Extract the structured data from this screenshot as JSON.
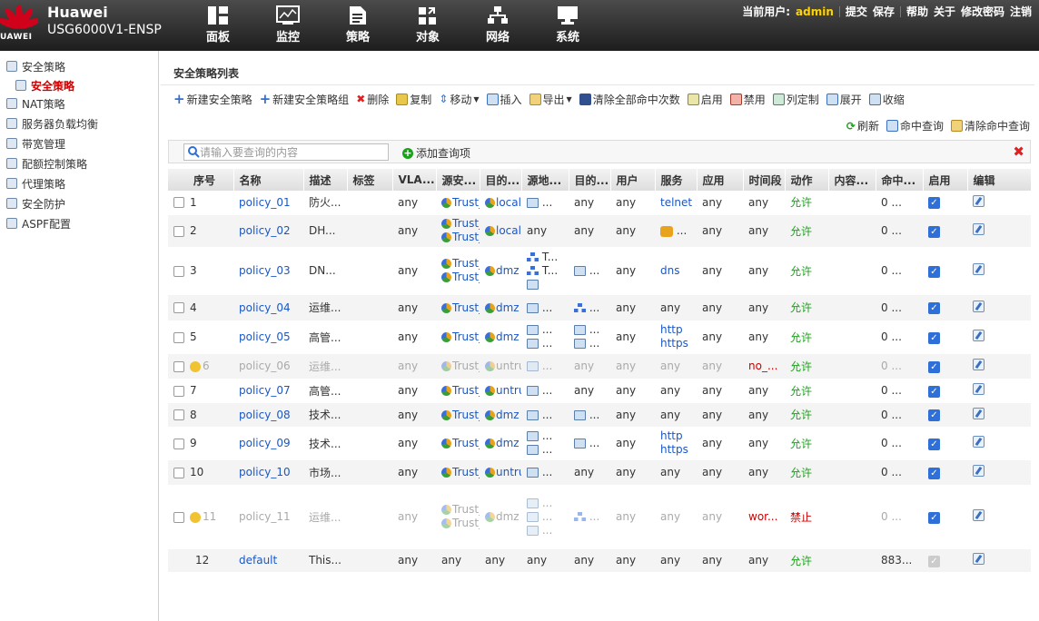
{
  "header": {
    "logo_text": "UAWEI",
    "brand": "Huawei",
    "model": "USG6000V1-ENSP",
    "nav": [
      "面板",
      "监控",
      "策略",
      "对象",
      "网络",
      "系统"
    ],
    "user_label": "当前用户:",
    "user_name": "admin",
    "links": [
      "提交",
      "保存",
      "帮助",
      "关于",
      "修改密码",
      "注销"
    ]
  },
  "sidebar": {
    "items": [
      "安全策略",
      "安全策略",
      "NAT策略",
      "服务器负载均衡",
      "带宽管理",
      "配额控制策略",
      "代理策略",
      "安全防护",
      "ASPF配置"
    ]
  },
  "main": {
    "title": "安全策略列表",
    "toolbar": [
      "新建安全策略",
      "新建安全策略组",
      "删除",
      "复制",
      "移动",
      "插入",
      "导出",
      "清除全部命中次数",
      "启用",
      "禁用",
      "列定制",
      "展开",
      "收缩"
    ],
    "toolbar2": [
      "刷新",
      "命中查询",
      "清除命中查询"
    ],
    "search_placeholder": "请输入要查询的内容",
    "add_query": "添加查询项"
  },
  "table": {
    "columns": [
      "序号",
      "名称",
      "描述",
      "标签",
      "VLA...",
      "源安...",
      "目的...",
      "源地...",
      "目的...",
      "用户",
      "服务",
      "应用",
      "时间段",
      "动作",
      "内容...",
      "命中...",
      "启用",
      "编辑"
    ],
    "rows": [
      {
        "no": "1",
        "name": "policy_01",
        "desc": "防火...",
        "vlan": "any",
        "src_zone": "Trust_",
        "dst_zone": "local",
        "src_addr": "...",
        "dst_addr": "any",
        "user": "any",
        "service": "telnet",
        "app": "any",
        "time": "any",
        "action": "允许",
        "hits": "0 ..."
      },
      {
        "no": "2",
        "name": "policy_02",
        "desc": "DH...",
        "vlan": "any",
        "src_zone": "Trust_",
        "src_zone2": "Trust_",
        "dst_zone": "local",
        "src_addr": "any",
        "dst_addr": "any",
        "user": "any",
        "service": "...",
        "app": "any",
        "time": "any",
        "action": "允许",
        "hits": "0 ..."
      },
      {
        "no": "3",
        "name": "policy_03",
        "desc": "DN...",
        "vlan": "any",
        "src_zone": "Trust_",
        "src_zone2": "Trust_",
        "dst_zone": "dmz",
        "src_addr": "T...",
        "src_addr2": "T...",
        "dst_addr": "...",
        "user": "any",
        "service": "dns",
        "app": "any",
        "time": "any",
        "action": "允许",
        "hits": "0 ..."
      },
      {
        "no": "4",
        "name": "policy_04",
        "desc": "运维...",
        "vlan": "any",
        "src_zone": "Trust_",
        "dst_zone": "dmz",
        "src_addr": "...",
        "dst_addr": "...",
        "user": "any",
        "service": "any",
        "app": "any",
        "time": "any",
        "action": "允许",
        "hits": "0 ..."
      },
      {
        "no": "5",
        "name": "policy_05",
        "desc": "高管...",
        "vlan": "any",
        "src_zone": "Trust_",
        "dst_zone": "dmz",
        "src_addr": "...",
        "src_addr2": "...",
        "dst_addr": "...",
        "dst_addr2": "...",
        "user": "any",
        "service": "http",
        "service2": "https",
        "app": "any",
        "time": "any",
        "action": "允许",
        "hits": "0 ..."
      },
      {
        "no": "6",
        "name": "policy_06",
        "desc": "运维...",
        "vlan": "any",
        "src_zone": "Trust_",
        "dst_zone": "untrus",
        "src_addr": "...",
        "dst_addr": "any",
        "user": "any",
        "service": "any",
        "app": "any",
        "time": "no_...",
        "action": "允许",
        "hits": "0 ..."
      },
      {
        "no": "7",
        "name": "policy_07",
        "desc": "高管...",
        "vlan": "any",
        "src_zone": "Trust_",
        "dst_zone": "untrus",
        "src_addr": "...",
        "dst_addr": "any",
        "user": "any",
        "service": "any",
        "app": "any",
        "time": "any",
        "action": "允许",
        "hits": "0 ..."
      },
      {
        "no": "8",
        "name": "policy_08",
        "desc": "技术...",
        "vlan": "any",
        "src_zone": "Trust_",
        "dst_zone": "dmz",
        "src_addr": "...",
        "dst_addr": "...",
        "user": "any",
        "service": "any",
        "app": "any",
        "time": "any",
        "action": "允许",
        "hits": "0 ..."
      },
      {
        "no": "9",
        "name": "policy_09",
        "desc": "技术...",
        "vlan": "any",
        "src_zone": "Trust_",
        "dst_zone": "dmz",
        "src_addr": "...",
        "src_addr2": "...",
        "dst_addr": "...",
        "user": "any",
        "service": "http",
        "service2": "https",
        "app": "any",
        "time": "any",
        "action": "允许",
        "hits": "0 ..."
      },
      {
        "no": "10",
        "name": "policy_10",
        "desc": "市场...",
        "vlan": "any",
        "src_zone": "Trust_",
        "dst_zone": "untrus",
        "src_addr": "...",
        "dst_addr": "any",
        "user": "any",
        "service": "any",
        "app": "any",
        "time": "any",
        "action": "允许",
        "hits": "0 ..."
      },
      {
        "no": "11",
        "name": "policy_11",
        "desc": "运维...",
        "vlan": "any",
        "src_zone": "Trust_",
        "src_zone2": "Trust_",
        "dst_zone": "dmz",
        "src_addr": "...",
        "src_addr2": "...",
        "src_addr3": "...",
        "dst_addr": "...",
        "user": "any",
        "service": "any",
        "app": "any",
        "time": "wor...",
        "action": "禁止",
        "hits": "0 ..."
      },
      {
        "no": "12",
        "name": "default",
        "desc": "This...",
        "vlan": "any",
        "src_zone": "any",
        "dst_zone": "any",
        "src_addr": "any",
        "dst_addr": "any",
        "user": "any",
        "service": "any",
        "app": "any",
        "time": "any",
        "action": "允许",
        "hits": "883..."
      }
    ]
  },
  "colors": {
    "accent": "#1a57c6",
    "allow": "#1aa31a",
    "deny": "#cc0000",
    "user": "#ffd200"
  }
}
